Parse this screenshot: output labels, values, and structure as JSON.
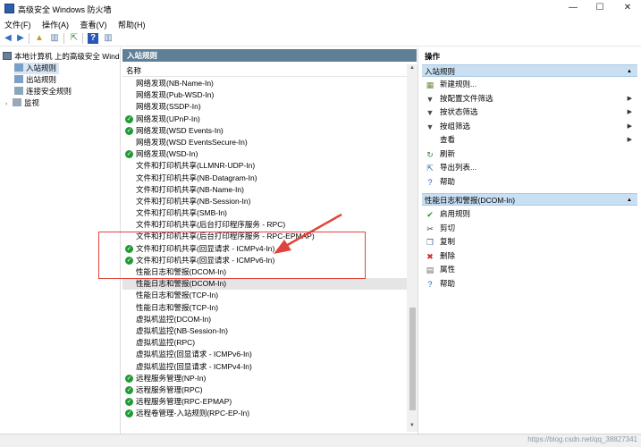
{
  "window": {
    "title": "高级安全 Windows 防火墙"
  },
  "menu": [
    "文件(F)",
    "操作(A)",
    "查看(V)",
    "帮助(H)"
  ],
  "tree": {
    "root": "本地计算机 上的高级安全 Windows",
    "items": [
      "入站规则",
      "出站规则",
      "连接安全规则",
      "监视"
    ]
  },
  "center": {
    "pane_title": "入站规则",
    "column_name": "名称",
    "rules": [
      {
        "name": "网络发现(NB-Name-In)",
        "enabled": false
      },
      {
        "name": "网络发现(Pub-WSD-In)",
        "enabled": false
      },
      {
        "name": "网络发现(SSDP-In)",
        "enabled": false
      },
      {
        "name": "网络发现(UPnP-In)",
        "enabled": true
      },
      {
        "name": "网络发现(WSD Events-In)",
        "enabled": true
      },
      {
        "name": "网络发现(WSD EventsSecure-In)",
        "enabled": false
      },
      {
        "name": "网络发现(WSD-In)",
        "enabled": true
      },
      {
        "name": "文件和打印机共享(LLMNR-UDP-In)",
        "enabled": false
      },
      {
        "name": "文件和打印机共享(NB-Datagram-In)",
        "enabled": false
      },
      {
        "name": "文件和打印机共享(NB-Name-In)",
        "enabled": false
      },
      {
        "name": "文件和打印机共享(NB-Session-In)",
        "enabled": false
      },
      {
        "name": "文件和打印机共享(SMB-In)",
        "enabled": false
      },
      {
        "name": "文件和打印机共享(后台打印程序服务 - RPC)",
        "enabled": false
      },
      {
        "name": "文件和打印机共享(后台打印程序服务 - RPC-EPMAP)",
        "enabled": false
      },
      {
        "name": "文件和打印机共享(回显请求 - ICMPv4-In)",
        "enabled": true
      },
      {
        "name": "文件和打印机共享(回显请求 - ICMPv6-In)",
        "enabled": true
      },
      {
        "name": "性能日志和警报(DCOM-In)",
        "enabled": false
      },
      {
        "name": "性能日志和警报(DCOM-In)",
        "enabled": false,
        "selected": true
      },
      {
        "name": "性能日志和警报(TCP-In)",
        "enabled": false
      },
      {
        "name": "性能日志和警报(TCP-In)",
        "enabled": false
      },
      {
        "name": "虚拟机监控(DCOM-In)",
        "enabled": false
      },
      {
        "name": "虚拟机监控(NB-Session-In)",
        "enabled": false
      },
      {
        "name": "虚拟机监控(RPC)",
        "enabled": false
      },
      {
        "name": "虚拟机监控(回显请求 - ICMPv6-In)",
        "enabled": false
      },
      {
        "name": "虚拟机监控(回显请求 - ICMPv4-In)",
        "enabled": false
      },
      {
        "name": "远程服务管理(NP-In)",
        "enabled": true
      },
      {
        "name": "远程服务管理(RPC)",
        "enabled": true
      },
      {
        "name": "远程服务管理(RPC-EPMAP)",
        "enabled": true
      },
      {
        "name": "远程卷管理-入站规则(RPC-EP-In)",
        "enabled": true
      }
    ]
  },
  "actions": {
    "title": "操作",
    "section1": "入站规则",
    "section1_items": [
      {
        "label": "新建规则...",
        "icon": "new-rule-icon",
        "glyph": "▦",
        "color": "#6c8f3a",
        "submenu": false
      },
      {
        "label": "按配置文件筛选",
        "icon": "filter-icon",
        "glyph": "▼",
        "color": "#4b4b4b",
        "submenu": true
      },
      {
        "label": "按状态筛选",
        "icon": "filter-icon",
        "glyph": "▼",
        "color": "#4b4b4b",
        "submenu": true
      },
      {
        "label": "按组筛选",
        "icon": "filter-icon",
        "glyph": "▼",
        "color": "#4b4b4b",
        "submenu": true
      },
      {
        "label": "查看",
        "icon": "",
        "glyph": "",
        "color": "#000",
        "submenu": true
      },
      {
        "label": "刷新",
        "icon": "refresh-icon",
        "glyph": "↻",
        "color": "#2e8b3a",
        "submenu": false
      },
      {
        "label": "导出列表...",
        "icon": "export-icon",
        "glyph": "⇱",
        "color": "#3a6ea5",
        "submenu": false
      },
      {
        "label": "帮助",
        "icon": "help-icon",
        "glyph": "?",
        "color": "#2a56b8",
        "submenu": false
      }
    ],
    "section2": "性能日志和警报(DCOM-In)",
    "section2_items": [
      {
        "label": "启用规则",
        "icon": "enable-rule-icon",
        "glyph": "✔",
        "color": "#1f9a34"
      },
      {
        "label": "剪切",
        "icon": "cut-icon",
        "glyph": "✂",
        "color": "#3b3b3b"
      },
      {
        "label": "复制",
        "icon": "copy-icon",
        "glyph": "❐",
        "color": "#3a6ea5"
      },
      {
        "label": "删除",
        "icon": "delete-icon",
        "glyph": "✖",
        "color": "#d12a2a"
      },
      {
        "label": "属性",
        "icon": "properties-icon",
        "glyph": "▤",
        "color": "#6d6d6d"
      },
      {
        "label": "帮助",
        "icon": "help-icon",
        "glyph": "?",
        "color": "#2a56b8"
      }
    ]
  },
  "watermark": "https://blog.csdn.net/qq_38827341"
}
